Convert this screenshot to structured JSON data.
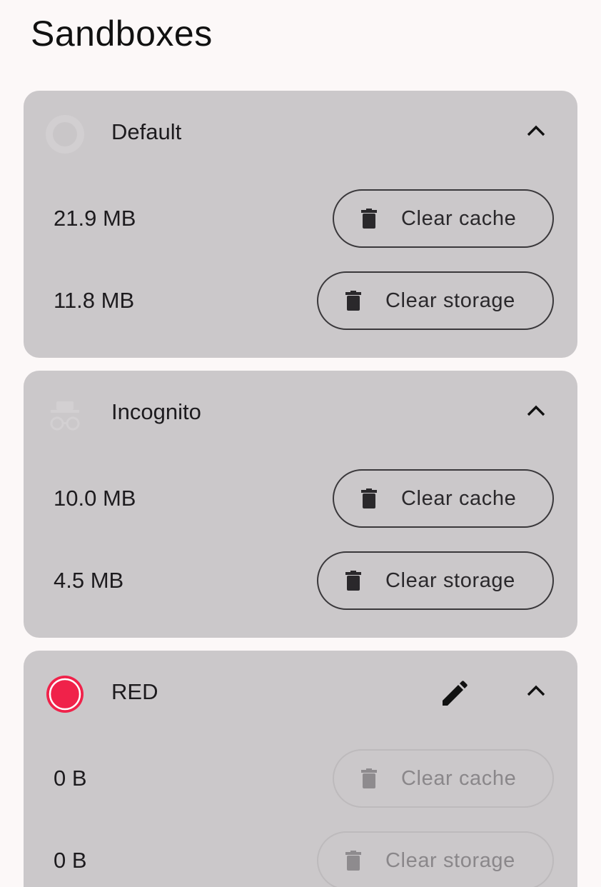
{
  "page": {
    "title": "Sandboxes"
  },
  "colors": {
    "background": "#fcf8f8",
    "card": "#cbc8ca",
    "red_accent": "#f0224a",
    "text": "#1d1b1e"
  },
  "sandboxes": [
    {
      "name": "Default",
      "icon": "default-sandbox-icon",
      "expanded": true,
      "editable": false,
      "cache_size": "21.9 MB",
      "storage_size": "11.8 MB",
      "clear_cache_label": "Clear cache",
      "clear_storage_label": "Clear storage",
      "buttons_enabled": true
    },
    {
      "name": "Incognito",
      "icon": "incognito-icon",
      "expanded": true,
      "editable": false,
      "cache_size": "10.0 MB",
      "storage_size": "4.5 MB",
      "clear_cache_label": "Clear cache",
      "clear_storage_label": "Clear storage",
      "buttons_enabled": true
    },
    {
      "name": "RED",
      "icon": "red-circle-icon",
      "expanded": true,
      "editable": true,
      "cache_size": "0 B",
      "storage_size": "0 B",
      "clear_cache_label": "Clear cache",
      "clear_storage_label": "Clear storage",
      "buttons_enabled": false
    }
  ]
}
